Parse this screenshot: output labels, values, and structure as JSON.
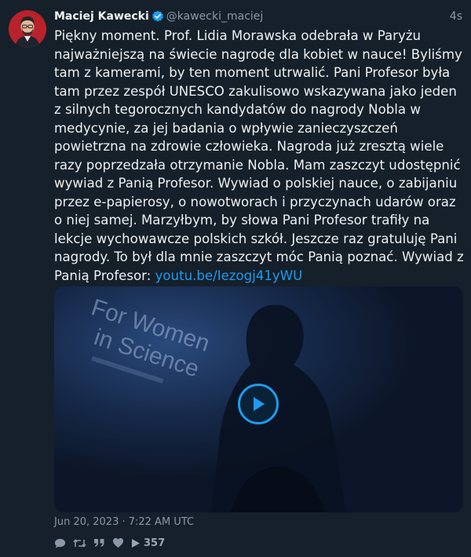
{
  "tweet": {
    "author": {
      "name": "Maciej Kawecki",
      "handle": "@kawecki_maciej",
      "verified": true
    },
    "time_ago": "4s",
    "text_plain": "Piękny moment. Prof. Lidia Morawska odebrała w Paryżu najważniejszą na świecie nagrodę dla kobiet w nauce! Byliśmy tam z kamerami, by ten moment utrwalić. Pani Profesor była tam przez zespół UNESCO zakulisowo wskazywana jako jeden z silnych tegorocznych kandydatów do nagrody Nobla w medycynie, za jej badania o wpływie zanieczyszczeń powietrzna na zdrowie człowieka. Nagroda już zresztą wiele razy poprzedzała otrzymanie Nobla. Mam zaszczyt udostępnić wywiad z Panią Profesor. Wywiad o polskiej nauce, o zabijaniu przez e-papierosy, o nowotworach i przyczynach udarów oraz o niej samej. Marzyłbym, by słowa Pani Profesor trafiły na lekcje wychowawcze polskich szkół. Jeszcze raz gratuluję Pani nagrody. To był dla mnie zaszczyt móc Panią poznać. Wywiad z Panią Profesor: ",
    "link_text": "youtu.be/Iezogj41yWU",
    "media": {
      "backdrop_text_line1": "For Women",
      "backdrop_text_line2": "in Science"
    },
    "date": "Jun 20, 2023 · 7:22 AM UTC",
    "stats": {
      "views": "357"
    },
    "colors": {
      "background": "#15202b",
      "accent": "#1d9bf0",
      "muted": "#8b98a5"
    }
  }
}
